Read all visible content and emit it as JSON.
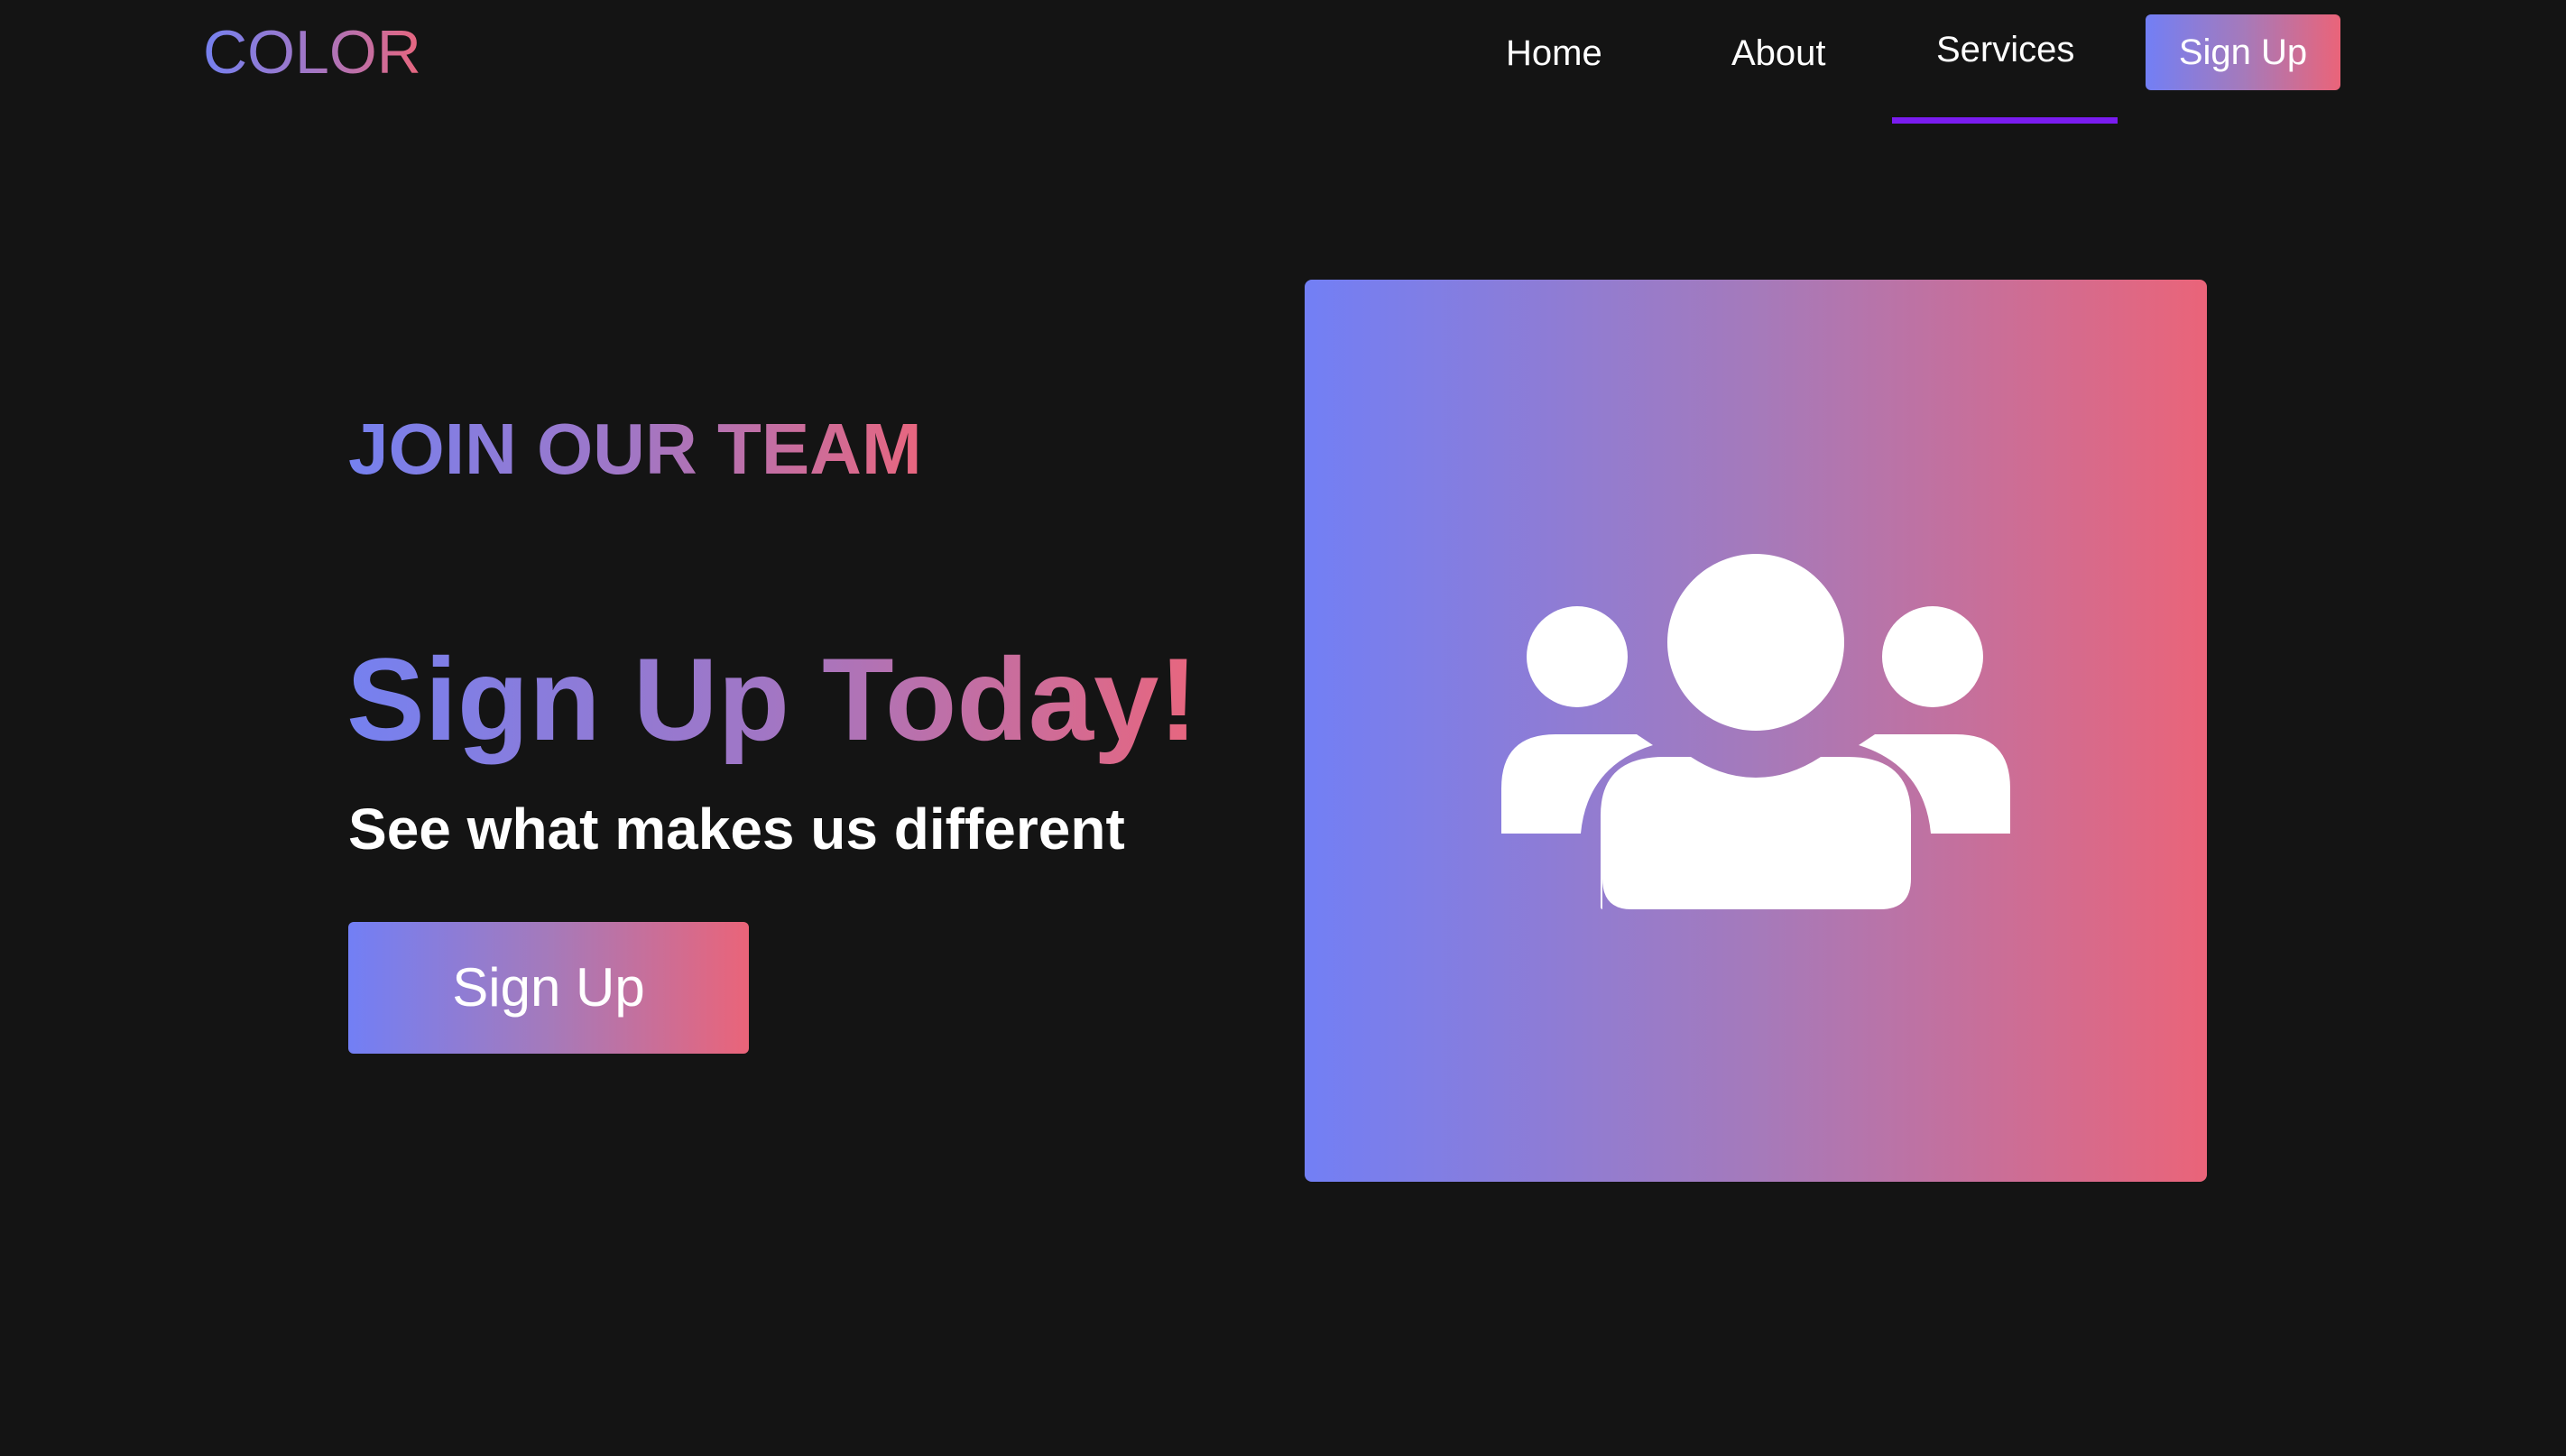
{
  "navbar": {
    "logo": "COLOR",
    "links": [
      {
        "label": "Home"
      },
      {
        "label": "About"
      },
      {
        "label": "Services",
        "active": true
      }
    ],
    "signup_label": "Sign Up"
  },
  "hero": {
    "kicker": "JOIN OUR TEAM",
    "title": "Sign Up Today!",
    "subtitle": "See what makes us different",
    "button_label": "Sign Up",
    "image_icon": "users-group-icon"
  },
  "colors": {
    "background": "#141414",
    "gradient_start": "#727ff5",
    "gradient_mid": "#a57abb",
    "gradient_end": "#ea6479",
    "active_underline": "#7a1cf0",
    "text": "#ffffff"
  }
}
